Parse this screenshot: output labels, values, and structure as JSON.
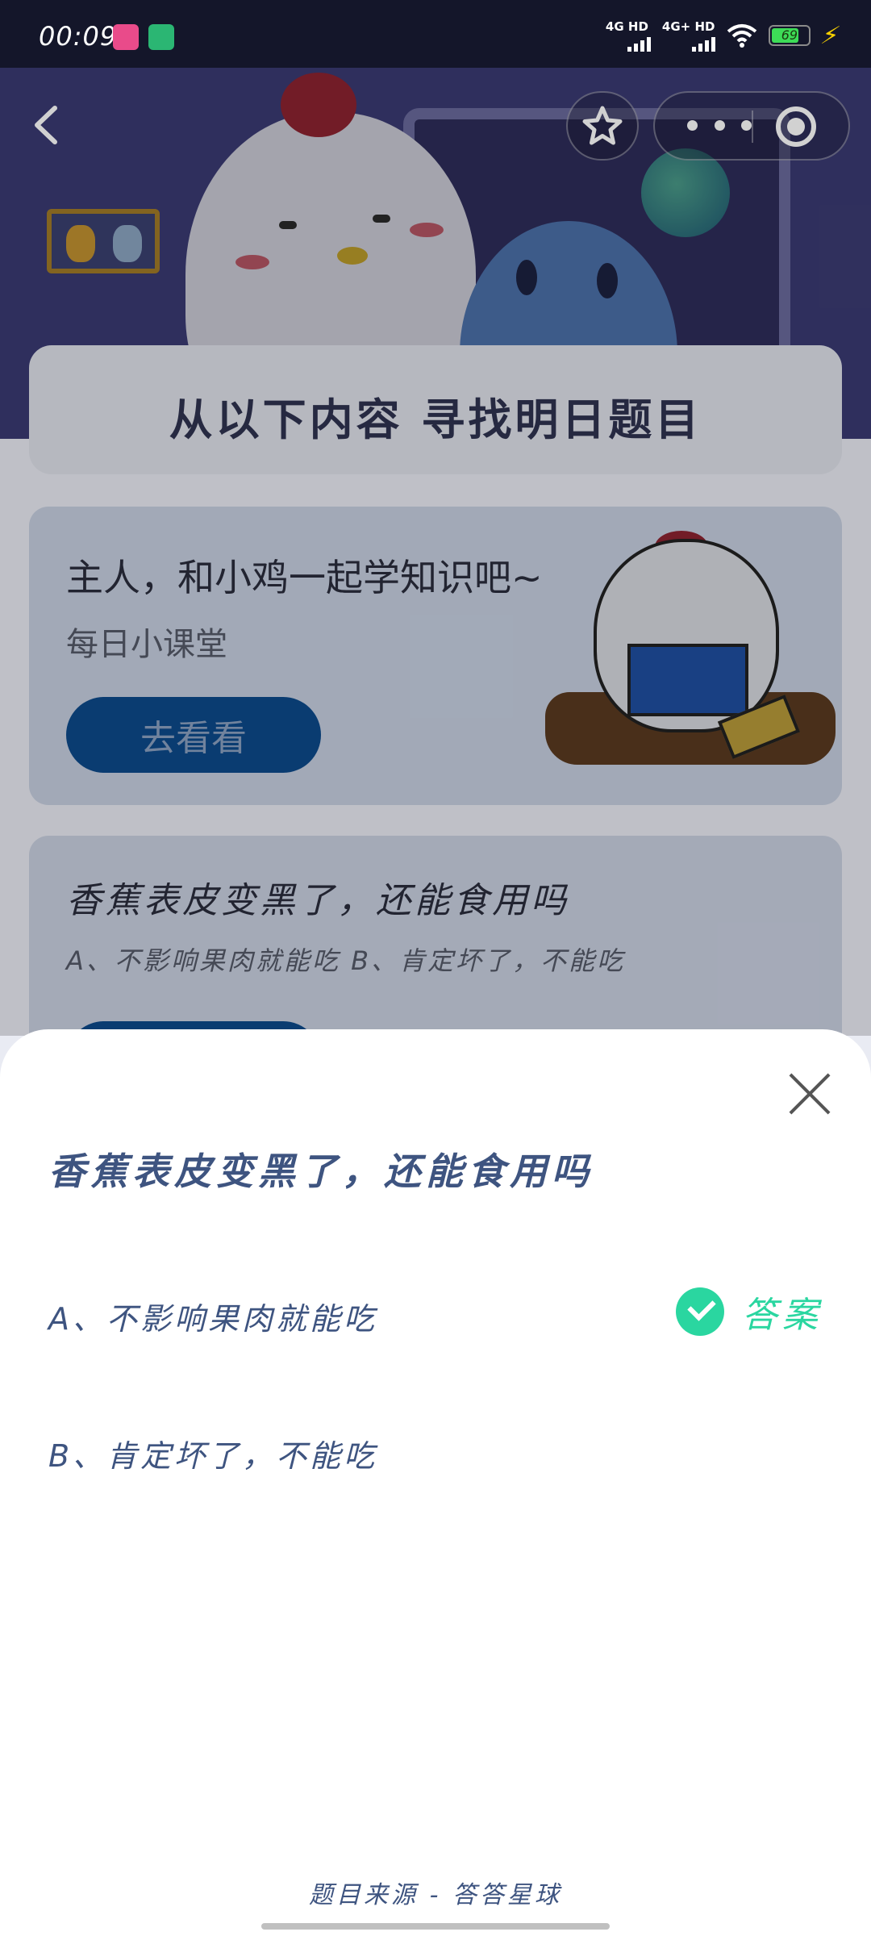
{
  "status_bar": {
    "time": "00:09",
    "signal_1_label": "4G HD",
    "signal_2_label": "4G+ HD",
    "battery": "69"
  },
  "banner": {
    "find_title": "从以下内容  寻找明日题目"
  },
  "learn_card": {
    "title": "主人，和小鸡一起学知识吧~",
    "subtitle": "每日小课堂",
    "button": "去看看"
  },
  "quiz_card": {
    "question": "香蕉表皮变黑了，还能食用吗",
    "options_line": "A、不影响果肉就能吃    B、肯定坏了，不能吃"
  },
  "sheet": {
    "question": "香蕉表皮变黑了，还能食用吗",
    "options": [
      {
        "text": "A、不影响果肉就能吃",
        "is_answer": true
      },
      {
        "text": "B、肯定坏了，不能吃",
        "is_answer": false
      }
    ],
    "answer_label": "答案",
    "source": "题目来源 - 答答星球"
  },
  "colors": {
    "accent": "#2ad6a0",
    "text": "#3e5480",
    "button": "#0d4a8a"
  },
  "icons": [
    "back-icon",
    "star-icon",
    "more-icon",
    "target-icon",
    "close-icon",
    "check-icon"
  ]
}
